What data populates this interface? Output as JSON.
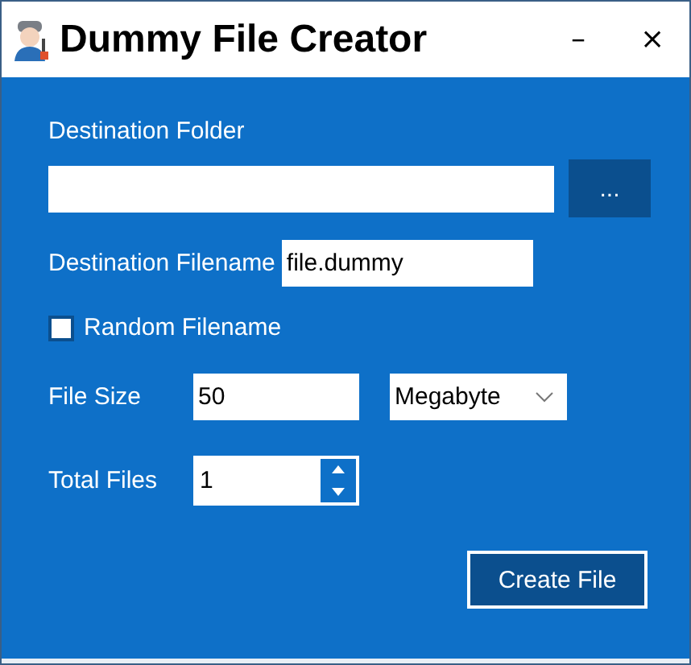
{
  "window": {
    "title": "Dummy File Creator",
    "controls": [
      "–",
      "×"
    ]
  },
  "destination_folder": {
    "label": "Destination Folder",
    "browse_button": "..."
  },
  "destination_filename": {
    "label": "Destination Filename",
    "value": "file.dummy"
  },
  "random_filename": {
    "label": "Random Filename",
    "checked": false
  },
  "file_size": {
    "label": "File Size",
    "value": "50",
    "unit": "Megabyte"
  },
  "total_files": {
    "label": "Total Files",
    "value": "1"
  },
  "create_button": "Create File"
}
